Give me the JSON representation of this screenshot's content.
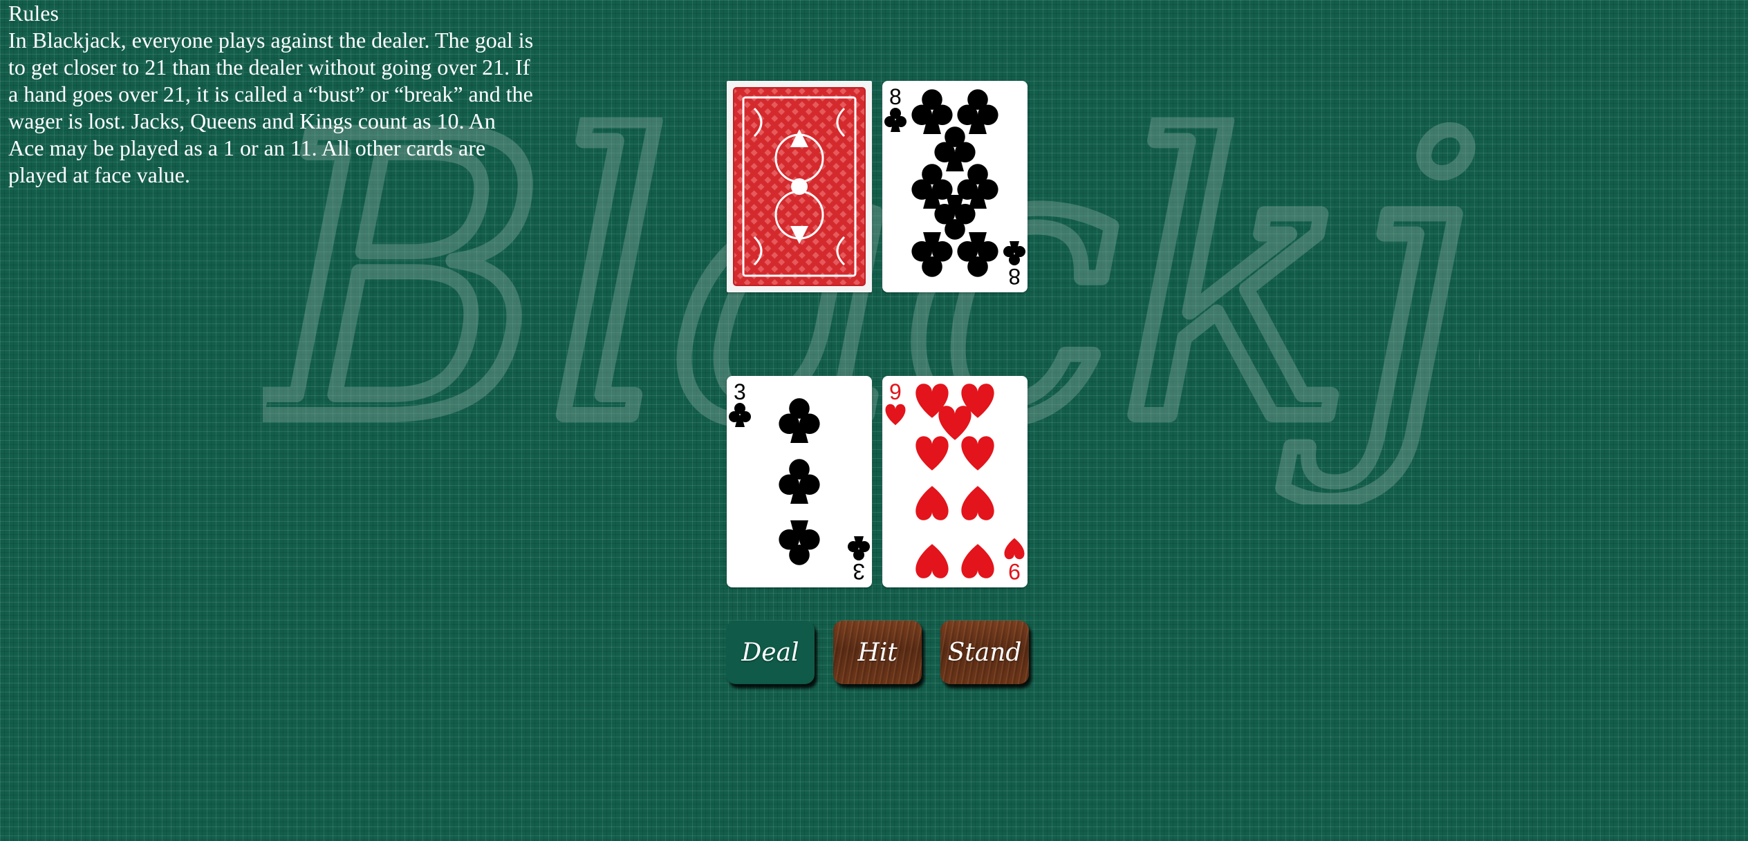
{
  "watermark": {
    "text": "Blackjack"
  },
  "rules": {
    "title": "Rules",
    "text": "In Blackjack, everyone plays against the dealer. The goal is to get closer to 21 than the dealer without going over 21. If a hand goes over 21, it is called a “bust” or “break” and the wager is lost. Jacks, Queens and Kings count as 10. An Ace may be played as a 1 or an 11. All other cards are played at face value."
  },
  "dealer": {
    "cards": [
      {
        "face": "down",
        "back_color": "#d42a2e"
      },
      {
        "rank": "8",
        "suit": "clubs",
        "color": "#000000"
      }
    ]
  },
  "player": {
    "cards": [
      {
        "rank": "3",
        "suit": "clubs",
        "color": "#000000"
      },
      {
        "rank": "9",
        "suit": "hearts",
        "color": "#e3141b"
      }
    ]
  },
  "controls": {
    "deal_label": "Deal",
    "hit_label": "Hit",
    "stand_label": "Stand"
  },
  "colors": {
    "felt": "#135e4b",
    "wood": "#5b2d16",
    "heart_red": "#e3141b",
    "back_red": "#d42a2e"
  }
}
